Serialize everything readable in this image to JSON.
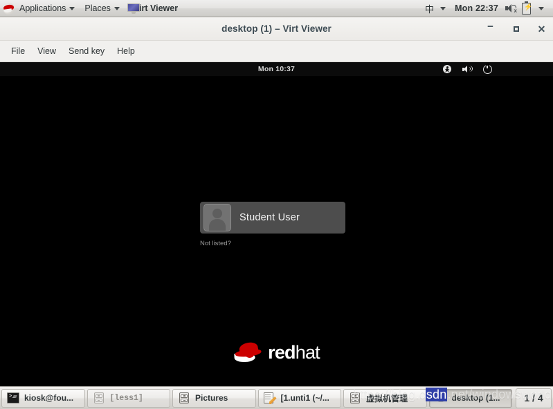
{
  "top_panel": {
    "logo_icon": "redhat-logo-icon",
    "menus": [
      {
        "label": "Applications",
        "icon": "redhat-logo-icon"
      },
      {
        "label": "Places",
        "icon": null
      }
    ],
    "window_item": {
      "label": "Virt Viewer",
      "icon": "monitor-icon"
    },
    "ime": {
      "label": "中",
      "icon": "chevron-down-icon"
    },
    "clock": "Mon 22:37",
    "tray": {
      "volume_icon": "volume-muted-icon",
      "battery_icon": "battery-charging-icon",
      "chevron_icon": "chevron-down-icon"
    }
  },
  "virt_viewer": {
    "title": "desktop (1) – Virt Viewer",
    "controls": {
      "minimize": "−",
      "maximize": "□",
      "close": "✕"
    },
    "menu": [
      {
        "label": "File"
      },
      {
        "label": "View"
      },
      {
        "label": "Send key"
      },
      {
        "label": "Help"
      }
    ]
  },
  "guest": {
    "topbar": {
      "clock": "Mon 10:37",
      "accessibility_icon": "accessibility-icon",
      "volume_icon": "volume-icon",
      "power_icon": "power-icon"
    },
    "login": {
      "user_name": "Student User",
      "avatar_icon": "user-avatar-icon",
      "not_listed_label": "Not listed?"
    },
    "branding": {
      "logo_icon": "redhat-fedora-icon",
      "word_bold": "red",
      "word_light": "hat"
    }
  },
  "taskbar": {
    "items": [
      {
        "label": "kiosk@fou...",
        "icon": "terminal-icon",
        "state": "normal"
      },
      {
        "label": "[less1]",
        "icon": "file-manager-icon",
        "state": "minimized"
      },
      {
        "label": "Pictures",
        "icon": "file-manager-icon",
        "state": "normal"
      },
      {
        "label": "[1.unti1 (~/...",
        "icon": "text-editor-icon",
        "state": "normal"
      },
      {
        "label": "虚拟机管理",
        "icon": "file-manager-icon",
        "state": "normal"
      },
      {
        "label": "desktop (1...",
        "icon": "monitor-icon",
        "state": "active"
      }
    ],
    "workspace_indicator": "1 / 4"
  },
  "watermark": {
    "prefix": "https://blog.c",
    "highlight": "sdn",
    "suffix": ".net/windowsworld"
  },
  "colors": {
    "accent_red": "#cc0000",
    "panel_bg": "#e4e3e1",
    "guest_bg": "#000000",
    "title_text": "#3d4b53"
  }
}
